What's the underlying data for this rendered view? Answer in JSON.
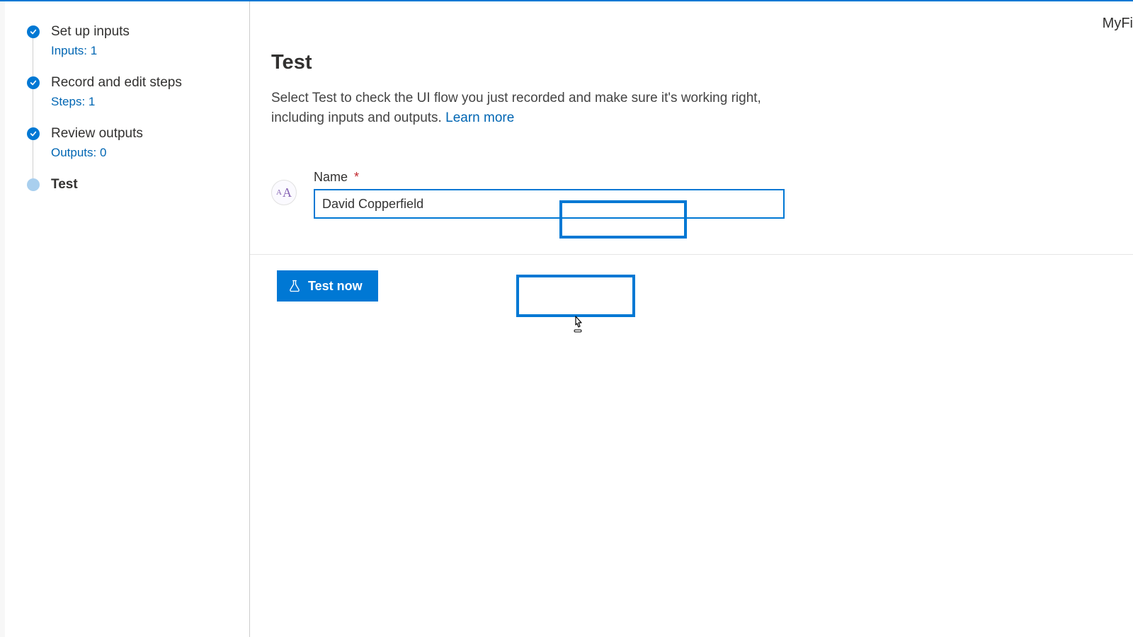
{
  "header": {
    "flow_name": "MyFi"
  },
  "sidebar": {
    "steps": [
      {
        "title": "Set up inputs",
        "sub": "Inputs: 1",
        "state": "done"
      },
      {
        "title": "Record and edit steps",
        "sub": "Steps: 1",
        "state": "done"
      },
      {
        "title": "Review outputs",
        "sub": "Outputs: 0",
        "state": "done"
      },
      {
        "title": "Test",
        "sub": "",
        "state": "current"
      }
    ]
  },
  "main": {
    "title": "Test",
    "description_prefix": "Select Test to check the UI flow you just recorded and make sure it's working right, including inputs and outputs. ",
    "learn_more": "Learn more",
    "field": {
      "label": "Name",
      "required_mark": "*",
      "value": "David Copperfield"
    },
    "test_button": "Test now"
  }
}
